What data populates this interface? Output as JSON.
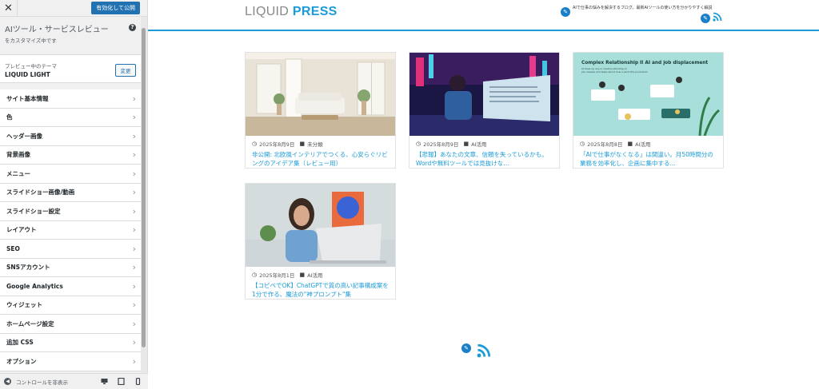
{
  "sidebar": {
    "close_symbol": "✕",
    "publish_label": "有効化して公開",
    "header_title": "AIツール・サービスレビュー",
    "header_sub": "をカスタマイズ中です",
    "help_symbol": "?",
    "theme_pre": "プレビュー中のテーマ",
    "theme_name": "LIQUID LIGHT",
    "change_label": "変更",
    "items": [
      {
        "label": "サイト基本情報"
      },
      {
        "label": "色"
      },
      {
        "label": "ヘッダー画像"
      },
      {
        "label": "背景画像"
      },
      {
        "label": "メニュー"
      },
      {
        "label": "スライドショー画像/動画"
      },
      {
        "label": "スライドショー設定"
      },
      {
        "label": "レイアウト"
      },
      {
        "label": "SEO"
      },
      {
        "label": "SNSアカウント"
      },
      {
        "label": "Google Analytics"
      },
      {
        "label": "ウィジェット"
      },
      {
        "label": "ホームページ設定"
      },
      {
        "label": "追加 CSS"
      },
      {
        "label": "オプション"
      }
    ],
    "chevron": "›",
    "hide_label": "コントロールを非表示",
    "device_icons": [
      "desktop-icon",
      "tablet-icon",
      "mobile-icon"
    ]
  },
  "site": {
    "logo_a": "LIQUID",
    "logo_b": "PRESS",
    "description": "AIで仕事の悩みを解決するブログ。最新AIツールの使い方を分かりやすく解説",
    "accent": "#1a9bd7",
    "edit_symbol": "✎"
  },
  "posts": [
    {
      "date": "2025年8月9日",
      "category": "未分類",
      "title": "非公開: 北欧風インテリアでつくる、心安らぐリビングのアイデア集（レビュー用）",
      "image": "living-room-photo"
    },
    {
      "date": "2025年8月9日",
      "category": "AI活用",
      "title": "【悲報】あなたの文章、信頼を失っているかも。Wordや無料ツールでは見抜けな…",
      "image": "neon-coder-illustration"
    },
    {
      "date": "2025年8月8日",
      "category": "AI活用",
      "title": "「AIで仕事がなくなる」は間違い。月50時間分の業務を効率化し、企画に集中する…",
      "image": "complex-relationship-illustration",
      "image_heading": "Complex Relationship II AI and job displacement",
      "image_sub": "AI frees up any a creative standing on",
      "image_sub2": "job reviews and tasks about how a work the production"
    },
    {
      "date": "2025年8月1日",
      "category": "AI活用",
      "title": "【コピペでOK】ChatGPTで質の高い記事構成案を1分で作る、魔法の\"神プロンプト\"集",
      "image": "woman-laptop-photo"
    }
  ]
}
